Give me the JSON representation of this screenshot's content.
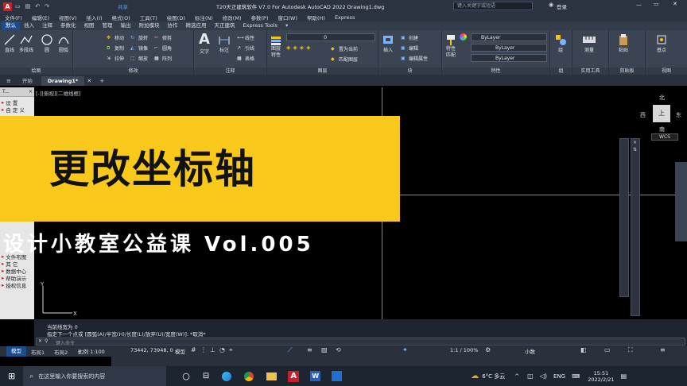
{
  "titlebar": {
    "share": "共享",
    "title": "T20天正建筑软件 V7.0 For Autodesk AutoCAD 2022    Drawing1.dwg",
    "search_placeholder": "键入关键字或短语",
    "login": "登录"
  },
  "menu": [
    "文件(F)",
    "编辑(E)",
    "视图(V)",
    "插入(I)",
    "格式(O)",
    "工具(T)",
    "绘图(D)",
    "标注(N)",
    "修改(M)",
    "参数(P)",
    "窗口(W)",
    "帮助(H)",
    "Express"
  ],
  "ribbon_tabs": [
    "默认",
    "插入",
    "注释",
    "参数化",
    "视图",
    "管理",
    "输出",
    "附加模块",
    "协作",
    "精选应用",
    "天正建筑",
    "Express Tools"
  ],
  "ribbon": {
    "draw": {
      "label": "绘图",
      "tools": [
        "直线",
        "多段线",
        "圆",
        "圆弧"
      ]
    },
    "modify": {
      "label": "修改",
      "tools": [
        "移动",
        "旋转",
        "修剪",
        "复制",
        "镜像",
        "圆角",
        "拉伸",
        "缩放",
        "阵列"
      ]
    },
    "annotation": {
      "label": "注释",
      "tools": [
        "文字",
        "标注",
        "线性",
        "引线",
        "表格"
      ]
    },
    "layers": {
      "label": "图层",
      "tools": [
        "图层特性",
        "置为当前",
        "匹配图层"
      ],
      "current": "0"
    },
    "block": {
      "label": "块",
      "tools": [
        "插入",
        "创建",
        "编辑",
        "编辑属性"
      ]
    },
    "properties": {
      "label": "特性",
      "tools": [
        "特性匹配"
      ],
      "bylayer": [
        "ByLayer",
        "ByLayer",
        "ByLayer"
      ]
    },
    "groups": {
      "label": "组",
      "tools": [
        "组"
      ]
    },
    "utilities": {
      "label": "实用工具",
      "tools": [
        "测量"
      ]
    },
    "clipboard": {
      "label": "剪贴板",
      "tools": [
        "粘贴"
      ]
    },
    "view": {
      "label": "视图",
      "tools": [
        "基点"
      ]
    }
  },
  "file_tabs": [
    "开始",
    "Drawing1*"
  ],
  "viewport_label": "[-][俯视][二维线框]",
  "palette": {
    "header": "T...",
    "items": [
      "设 置",
      "自 定 义",
      "文件布图",
      "其  它",
      "数据中心",
      "帮助演示",
      "授权信息"
    ]
  },
  "viewcube": {
    "north": "北",
    "south": "南",
    "east": "东",
    "west": "西",
    "top": "上",
    "wcs": "WCS"
  },
  "command": {
    "lines": [
      "当前线宽为 0",
      "指定下一个点或 [圆弧(A)/半宽(H)/长度(L)/放弃(U)/宽度(W)]: *取消*"
    ],
    "placeholder": "键入命令"
  },
  "layout_tabs": [
    "模型",
    "布局1",
    "布局2",
    "+"
  ],
  "status": {
    "scale": "比例 1:100",
    "coords": "73442, 73948, 0",
    "model": "模型",
    "annotation_scale": "1:1 / 100%",
    "units": "小数"
  },
  "taskbar": {
    "search_placeholder": "在这里输入你要搜索的内容",
    "weather": "6°C 多云",
    "lang": "ENG",
    "time": "15:51",
    "date": "2022/2/21"
  },
  "banner": {
    "title": "更改坐标轴",
    "subtitle": "设计小教室公益课    Vol.005"
  },
  "colors": {
    "banner": "#f8c81a",
    "accent": "#1b4c8c"
  }
}
